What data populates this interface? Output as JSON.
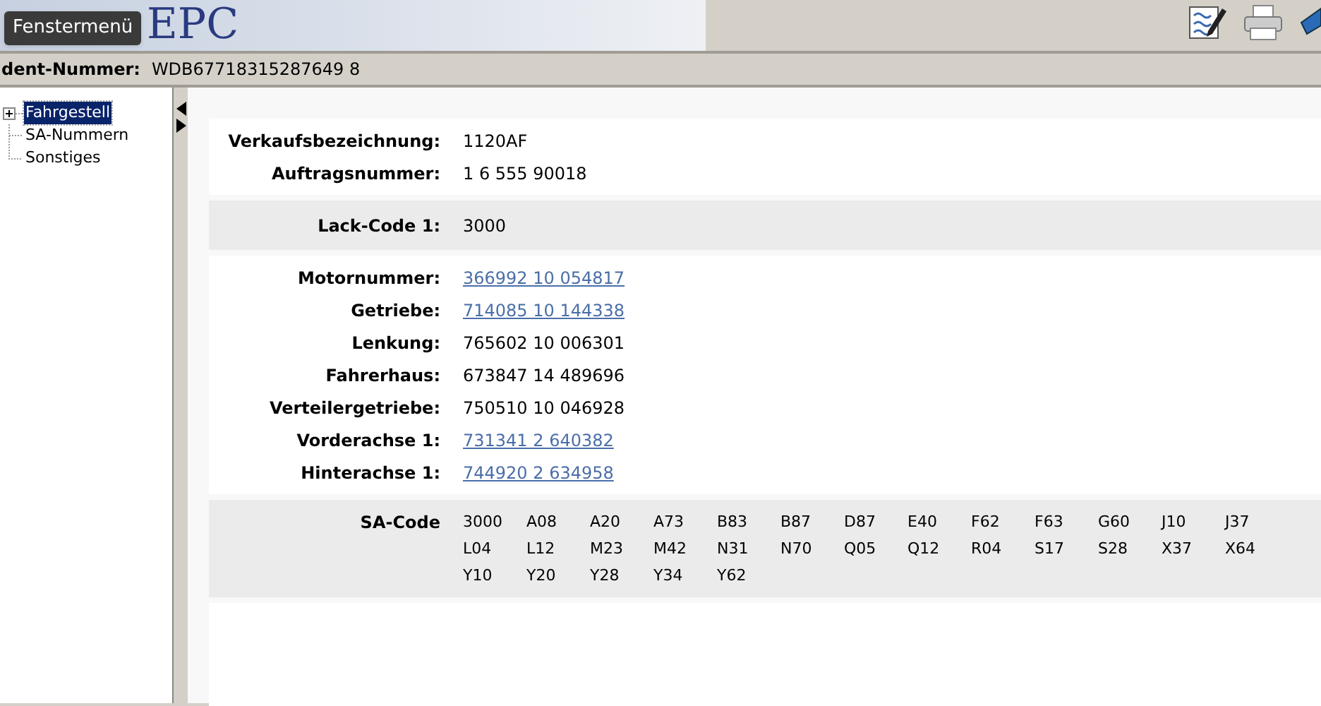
{
  "header": {
    "logo": "EPC",
    "tooltip": "Fenstermenü"
  },
  "ident": {
    "label": "dent-Nummer:",
    "value": "WDB67718315287649 8"
  },
  "tree": [
    {
      "label": "Fahrgestell",
      "kind": "folder",
      "selected": true
    },
    {
      "label": "SA-Nummern",
      "kind": "leaf",
      "selected": false
    },
    {
      "label": "Sonstiges",
      "kind": "leaf",
      "selected": false
    }
  ],
  "sections": [
    {
      "shaded": false,
      "fields": [
        {
          "label": "Verkaufsbezeichnung:",
          "value": "1120AF",
          "link": false
        },
        {
          "label": "Auftragsnummer:",
          "value": "1 6 555 90018",
          "link": false
        }
      ]
    },
    {
      "shaded": true,
      "fields": [
        {
          "label": "Lack-Code 1:",
          "value": "3000",
          "link": false
        }
      ]
    },
    {
      "shaded": false,
      "fields": [
        {
          "label": "Motornummer:",
          "value": "366992 10 054817",
          "link": true
        },
        {
          "label": "Getriebe:",
          "value": "714085 10 144338",
          "link": true
        },
        {
          "label": "Lenkung:",
          "value": "765602 10 006301",
          "link": false
        },
        {
          "label": "Fahrerhaus:",
          "value": "673847 14 489696",
          "link": false
        },
        {
          "label": "Verteilergetriebe:",
          "value": "750510 10 046928",
          "link": false
        },
        {
          "label": "Vorderachse 1:",
          "value": "731341 2 640382",
          "link": true
        },
        {
          "label": "Hinterachse 1:",
          "value": "744920 2 634958",
          "link": true
        }
      ]
    }
  ],
  "sa_code": {
    "label": "SA-Code",
    "codes": [
      "3000",
      "A08",
      "A20",
      "A73",
      "B83",
      "B87",
      "D87",
      "E40",
      "F62",
      "F63",
      "G60",
      "J10",
      "J37",
      "L04",
      "L12",
      "M23",
      "M42",
      "N31",
      "N70",
      "Q05",
      "Q12",
      "R04",
      "S17",
      "S28",
      "X37",
      "X64",
      "Y10",
      "Y20",
      "Y28",
      "Y34",
      "Y62"
    ]
  }
}
